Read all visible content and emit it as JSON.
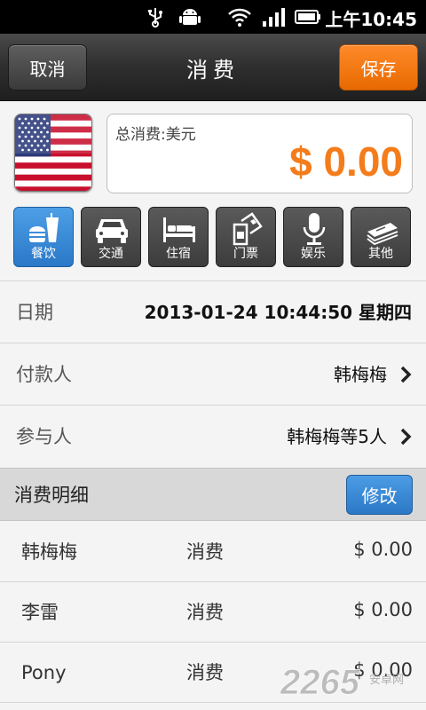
{
  "status_bar": {
    "time": "上午10:45",
    "icons": [
      "usb-icon",
      "android-icon",
      "wifi-icon",
      "signal-icon",
      "battery-icon"
    ]
  },
  "toolbar": {
    "cancel_label": "取消",
    "title": "消费",
    "save_label": "保存"
  },
  "currency": {
    "flag": "us-flag-icon",
    "label": "总消费:美元",
    "total": "$ 0.00",
    "total_color": "#f47c1b"
  },
  "categories": [
    {
      "label": "餐饮",
      "icon": "food-icon",
      "active": true
    },
    {
      "label": "交通",
      "icon": "car-icon",
      "active": false
    },
    {
      "label": "住宿",
      "icon": "bed-icon",
      "active": false
    },
    {
      "label": "门票",
      "icon": "ticket-icon",
      "active": false
    },
    {
      "label": "娱乐",
      "icon": "microphone-icon",
      "active": false
    },
    {
      "label": "其他",
      "icon": "money-icon",
      "active": false
    }
  ],
  "form": {
    "date": {
      "label": "日期",
      "value": "2013-01-24 10:44:50 星期四"
    },
    "payer": {
      "label": "付款人",
      "value": "韩梅梅"
    },
    "participants": {
      "label": "参与人",
      "value": "韩梅梅等5人"
    }
  },
  "details": {
    "title": "消费明细",
    "edit_label": "修改",
    "rows": [
      {
        "name": "韩梅梅",
        "type": "消费",
        "amount": "$ 0.00"
      },
      {
        "name": "李雷",
        "type": "消费",
        "amount": "$ 0.00"
      },
      {
        "name": "Pony",
        "type": "消费",
        "amount": "$ 0.00"
      }
    ]
  },
  "watermark": {
    "text": "2265",
    "sub": "安卓网"
  },
  "colors": {
    "accent_orange": "#f47c1b",
    "accent_blue": "#2c78c6",
    "toolbar_dark": "#2e2e2e"
  }
}
